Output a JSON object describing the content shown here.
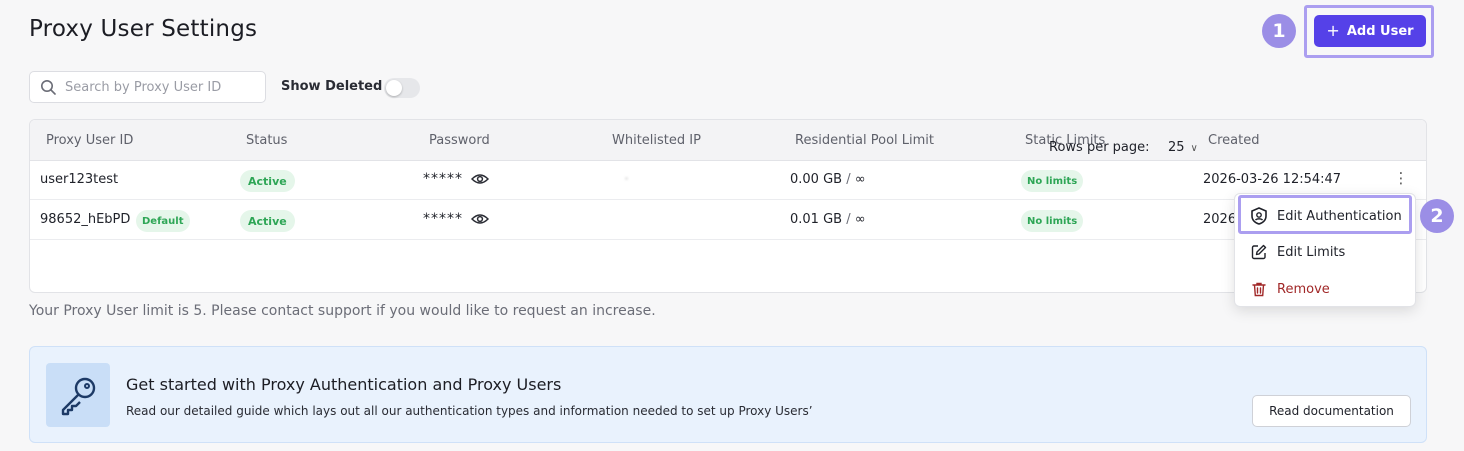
{
  "page": {
    "title": "Proxy User Settings"
  },
  "steps": {
    "one": "1",
    "two": "2"
  },
  "toolbar": {
    "add_user_label": "Add User",
    "add_user_icon": "plus-icon"
  },
  "filters": {
    "search_placeholder": "Search by Proxy User ID",
    "search_value": "",
    "show_deleted_label": "Show Deleted",
    "show_deleted_on": false
  },
  "table": {
    "headers": [
      "Proxy User ID",
      "Status",
      "Password",
      "Whitelisted IP",
      "Residential Pool Limit",
      "Static Limits",
      "Created"
    ],
    "rows": [
      {
        "id": "user123test",
        "default_badge": "",
        "status": "Active",
        "password": "*****",
        "whitelisted_ip": "",
        "residential_used": "0.00 GB",
        "residential_sep": "/",
        "residential_limit": "∞",
        "static_limits": "No limits",
        "created": "2026-03-26 12:54:47"
      },
      {
        "id": "98652_hEbPD",
        "default_badge": "Default",
        "status": "Active",
        "password": "*****",
        "whitelisted_ip": "",
        "residential_used": "0.01 GB",
        "residential_sep": "/",
        "residential_limit": "∞",
        "static_limits": "No limits",
        "created": "2026"
      }
    ],
    "pagination": {
      "rows_per_page_label": "Rows per page:",
      "rows_per_page_value": "25"
    }
  },
  "row_menu": {
    "items": [
      {
        "label": "Edit Authentication",
        "icon": "shield-user-icon"
      },
      {
        "label": "Edit Limits",
        "icon": "pencil-icon"
      },
      {
        "label": "Remove",
        "icon": "trash-icon"
      }
    ]
  },
  "notice": {
    "limit_text": "Your Proxy User limit is 5. Please contact support if you would like to request an increase."
  },
  "guide": {
    "title": "Get started with Proxy Authentication and Proxy Users",
    "description": "Read our detailed guide which lays out all our authentication types and information needed to set up Proxy Users’",
    "button_label": "Read documentation",
    "icon": "key-icon"
  },
  "colors": {
    "accent": "#5541e8",
    "highlight": "#ab9ef0",
    "badge_bg": "#e5f6ea",
    "badge_text": "#2ea656",
    "danger": "#a12828"
  }
}
